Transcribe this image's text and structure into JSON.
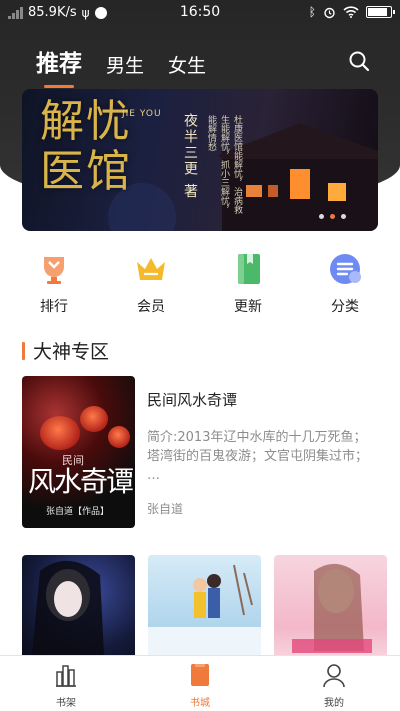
{
  "status_bar": {
    "speed": "85.9K/s",
    "time": "16:50",
    "battery_level": 0.9
  },
  "tabs": [
    {
      "label": "推荐",
      "active": true
    },
    {
      "label": "男生",
      "active": false
    },
    {
      "label": "女生",
      "active": false
    }
  ],
  "banner": {
    "title": "解忧医馆",
    "pinyin": "JIE YOU",
    "author": "夜半三更 著",
    "blurb": "杜康医馆能解忧，治病救生能解忧，抓小三解忧，能解情愁",
    "current_slide": 1,
    "slide_count": 3
  },
  "quick_menu": [
    {
      "label": "排行",
      "icon": "trophy-icon",
      "color": "#f07a3c"
    },
    {
      "label": "会员",
      "icon": "crown-icon",
      "color": "#f5b92c"
    },
    {
      "label": "更新",
      "icon": "book-update-icon",
      "color": "#4cb86a"
    },
    {
      "label": "分类",
      "icon": "category-icon",
      "color": "#6f8af2"
    }
  ],
  "section": {
    "title": "大神专区"
  },
  "featured_book": {
    "title": "民间风水奇谭",
    "description": "简介:2013年辽中水库的十几万死鱼；塔湾街的百鬼夜游；文官屯阴集过市；  …",
    "author": "张自道",
    "cover": {
      "tag": "民间",
      "mark": "风水奇谭",
      "author_line": "张自道【作品】"
    }
  },
  "more_books": [
    {
      "cover": "dark-figure-cover"
    },
    {
      "cover": "winter-couple-cover"
    },
    {
      "cover": "pink-romance-cover"
    }
  ],
  "bottom_nav": [
    {
      "label": "书架",
      "icon": "bookshelf-icon",
      "active": false
    },
    {
      "label": "书城",
      "icon": "bookstore-icon",
      "active": true
    },
    {
      "label": "我的",
      "icon": "profile-icon",
      "active": false
    }
  ],
  "colors": {
    "accent": "#f07a3c",
    "top_band": "#2b2b2b",
    "text_primary": "#222222",
    "text_secondary": "#8d8d8d"
  }
}
